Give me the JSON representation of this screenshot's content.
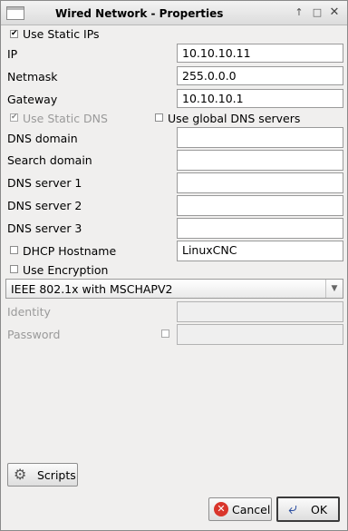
{
  "window": {
    "title": "Wired Network - Properties",
    "controls": {
      "up": "↑",
      "maximize": "□",
      "close": "✕"
    }
  },
  "use_static_ips": {
    "label": "Use Static IPs",
    "checked": true
  },
  "fields": {
    "ip": {
      "label": "IP",
      "value": "10.10.10.11"
    },
    "netmask": {
      "label": "Netmask",
      "value": "255.0.0.0"
    },
    "gateway": {
      "label": "Gateway",
      "value": "10.10.10.1"
    }
  },
  "use_static_dns": {
    "label": "Use Static DNS",
    "checked": true,
    "enabled": false
  },
  "use_global_dns": {
    "label": "Use global DNS servers",
    "checked": false
  },
  "dns": {
    "domain": {
      "label": "DNS domain",
      "value": ""
    },
    "search": {
      "label": "Search domain",
      "value": ""
    },
    "server1": {
      "label": "DNS server 1",
      "value": ""
    },
    "server2": {
      "label": "DNS server 2",
      "value": ""
    },
    "server3": {
      "label": "DNS server 3",
      "value": ""
    }
  },
  "dhcp_hostname": {
    "label": "DHCP Hostname",
    "checked": false,
    "value": "LinuxCNC"
  },
  "use_encryption": {
    "label": "Use Encryption",
    "checked": false
  },
  "encryption_type": {
    "selected": "IEEE 802.1x with MSCHAPV2"
  },
  "identity": {
    "label": "Identity",
    "value": ""
  },
  "password": {
    "label": "Password",
    "value": "",
    "show_checked": false
  },
  "buttons": {
    "scripts": "Scripts",
    "cancel": "Cancel",
    "ok": "OK"
  }
}
